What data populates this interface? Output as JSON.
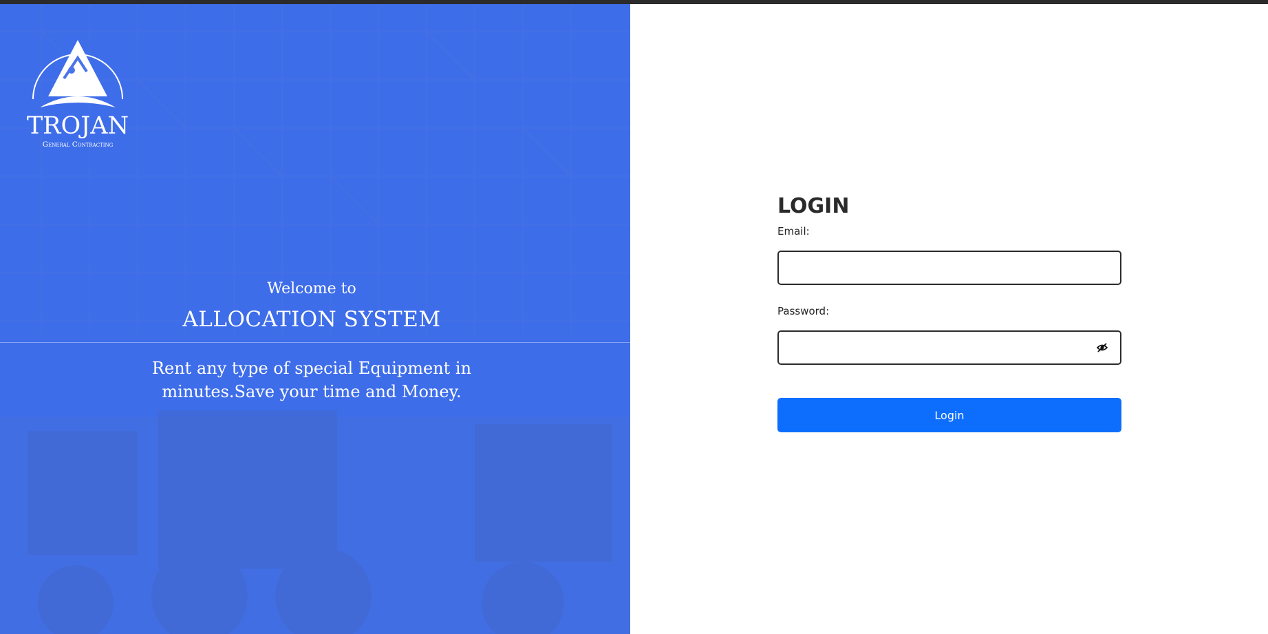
{
  "brand": {
    "logo_icon": "trojan-triangle-logo",
    "logo_name": "TROJAN",
    "logo_subtitle": "General Contracting"
  },
  "hero": {
    "welcome": "Welcome to",
    "system_name": "ALLOCATION SYSTEM",
    "tagline": "Rent any type of special Equipment in minutes.Save your time and Money."
  },
  "login": {
    "title": "LOGIN",
    "email_label": "Email:",
    "email_value": "",
    "password_label": "Password:",
    "password_value": "",
    "password_toggle_icon": "eye-slash-icon",
    "submit_label": "Login"
  },
  "colors": {
    "panel_overlay": "#3668f0",
    "button": "#0d6efd",
    "title_text": "#2b2b2b",
    "topbar": "#2b2b2b"
  }
}
